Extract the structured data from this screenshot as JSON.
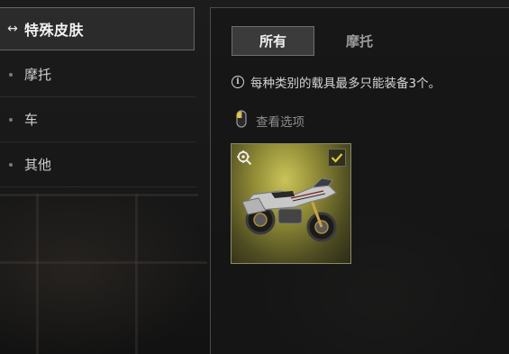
{
  "sidebar": {
    "header": {
      "icon": "left-right-arrows-icon",
      "label": "特殊皮肤"
    },
    "items": [
      {
        "label": "摩托"
      },
      {
        "label": "车"
      },
      {
        "label": "其他"
      }
    ]
  },
  "panel": {
    "tabs": [
      {
        "label": "所有",
        "active": true
      },
      {
        "label": "摩托",
        "active": false
      }
    ],
    "notice": {
      "icon": "info-icon",
      "text": "每种类别的载具最多只能装备3个。"
    },
    "view_options": {
      "icon": "mouse-icon",
      "label": "查看选项"
    },
    "skin_card": {
      "image": "motorcycle-skin",
      "equipped": true,
      "corner_icon": "inspect-gear-icon",
      "check_icon": "checkmark-icon",
      "accent_color": "#e8c93a"
    }
  },
  "colors": {
    "background": "#151515",
    "panel": "#161616",
    "active_tab": "#3b3b3b",
    "card_highlight": "#cbc45a"
  }
}
